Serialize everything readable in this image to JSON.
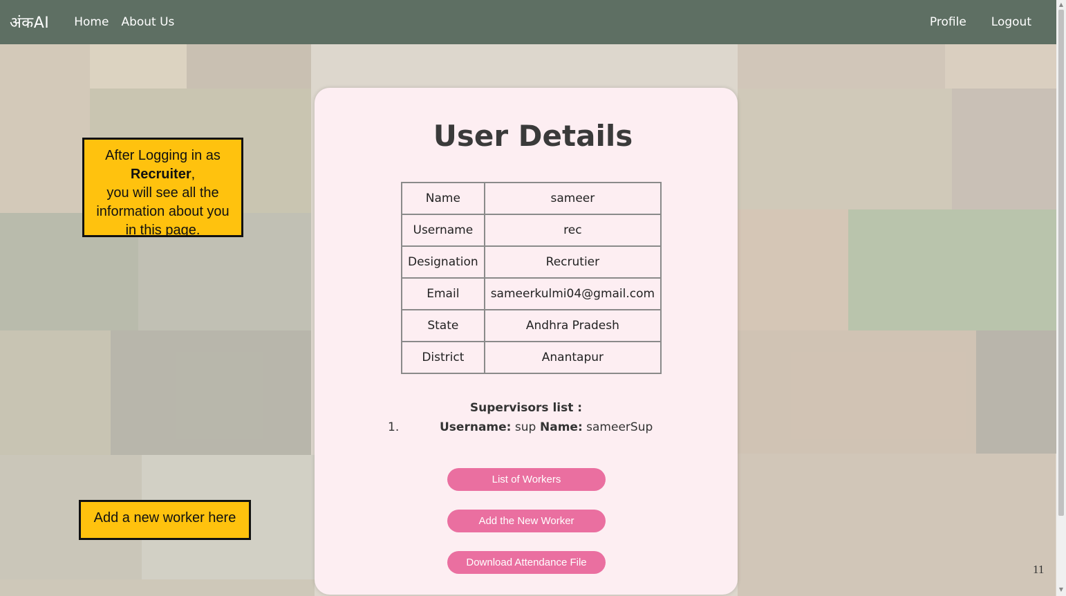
{
  "navbar": {
    "brand": "अंकAI",
    "links_left": [
      "Home",
      "About Us"
    ],
    "links_right": [
      "Profile",
      "Logout"
    ],
    "background_color": "#5e6f63"
  },
  "card": {
    "title": "User Details",
    "details": [
      {
        "key": "Name",
        "value": "sameer"
      },
      {
        "key": "Username",
        "value": "rec"
      },
      {
        "key": "Designation",
        "value": "Recrutier"
      },
      {
        "key": "Email",
        "value": "sameerkulmi04@gmail.com"
      },
      {
        "key": "State",
        "value": "Andhra Pradesh"
      },
      {
        "key": "District",
        "value": "Anantapur"
      }
    ],
    "supervisors": {
      "title": "Supervisors list :",
      "items": [
        {
          "number": "1.",
          "username_label": "Username:",
          "username": "sup",
          "name_label": "Name:",
          "name": "sameerSup"
        }
      ]
    },
    "buttons": [
      "List of Workers",
      "Add the New Worker",
      "Download Attendance File"
    ],
    "button_color": "#ea6fa0"
  },
  "annotations": {
    "note1_line1": "After Logging in as",
    "note1_bold": "Recruiter",
    "note1_comma": ",",
    "note1_line3": "you will see all the",
    "note1_line4": "information about you",
    "note1_line5": "in this page.",
    "note2": "Add a new worker here",
    "note_color": "#ffc20e"
  },
  "slide_number": "11"
}
